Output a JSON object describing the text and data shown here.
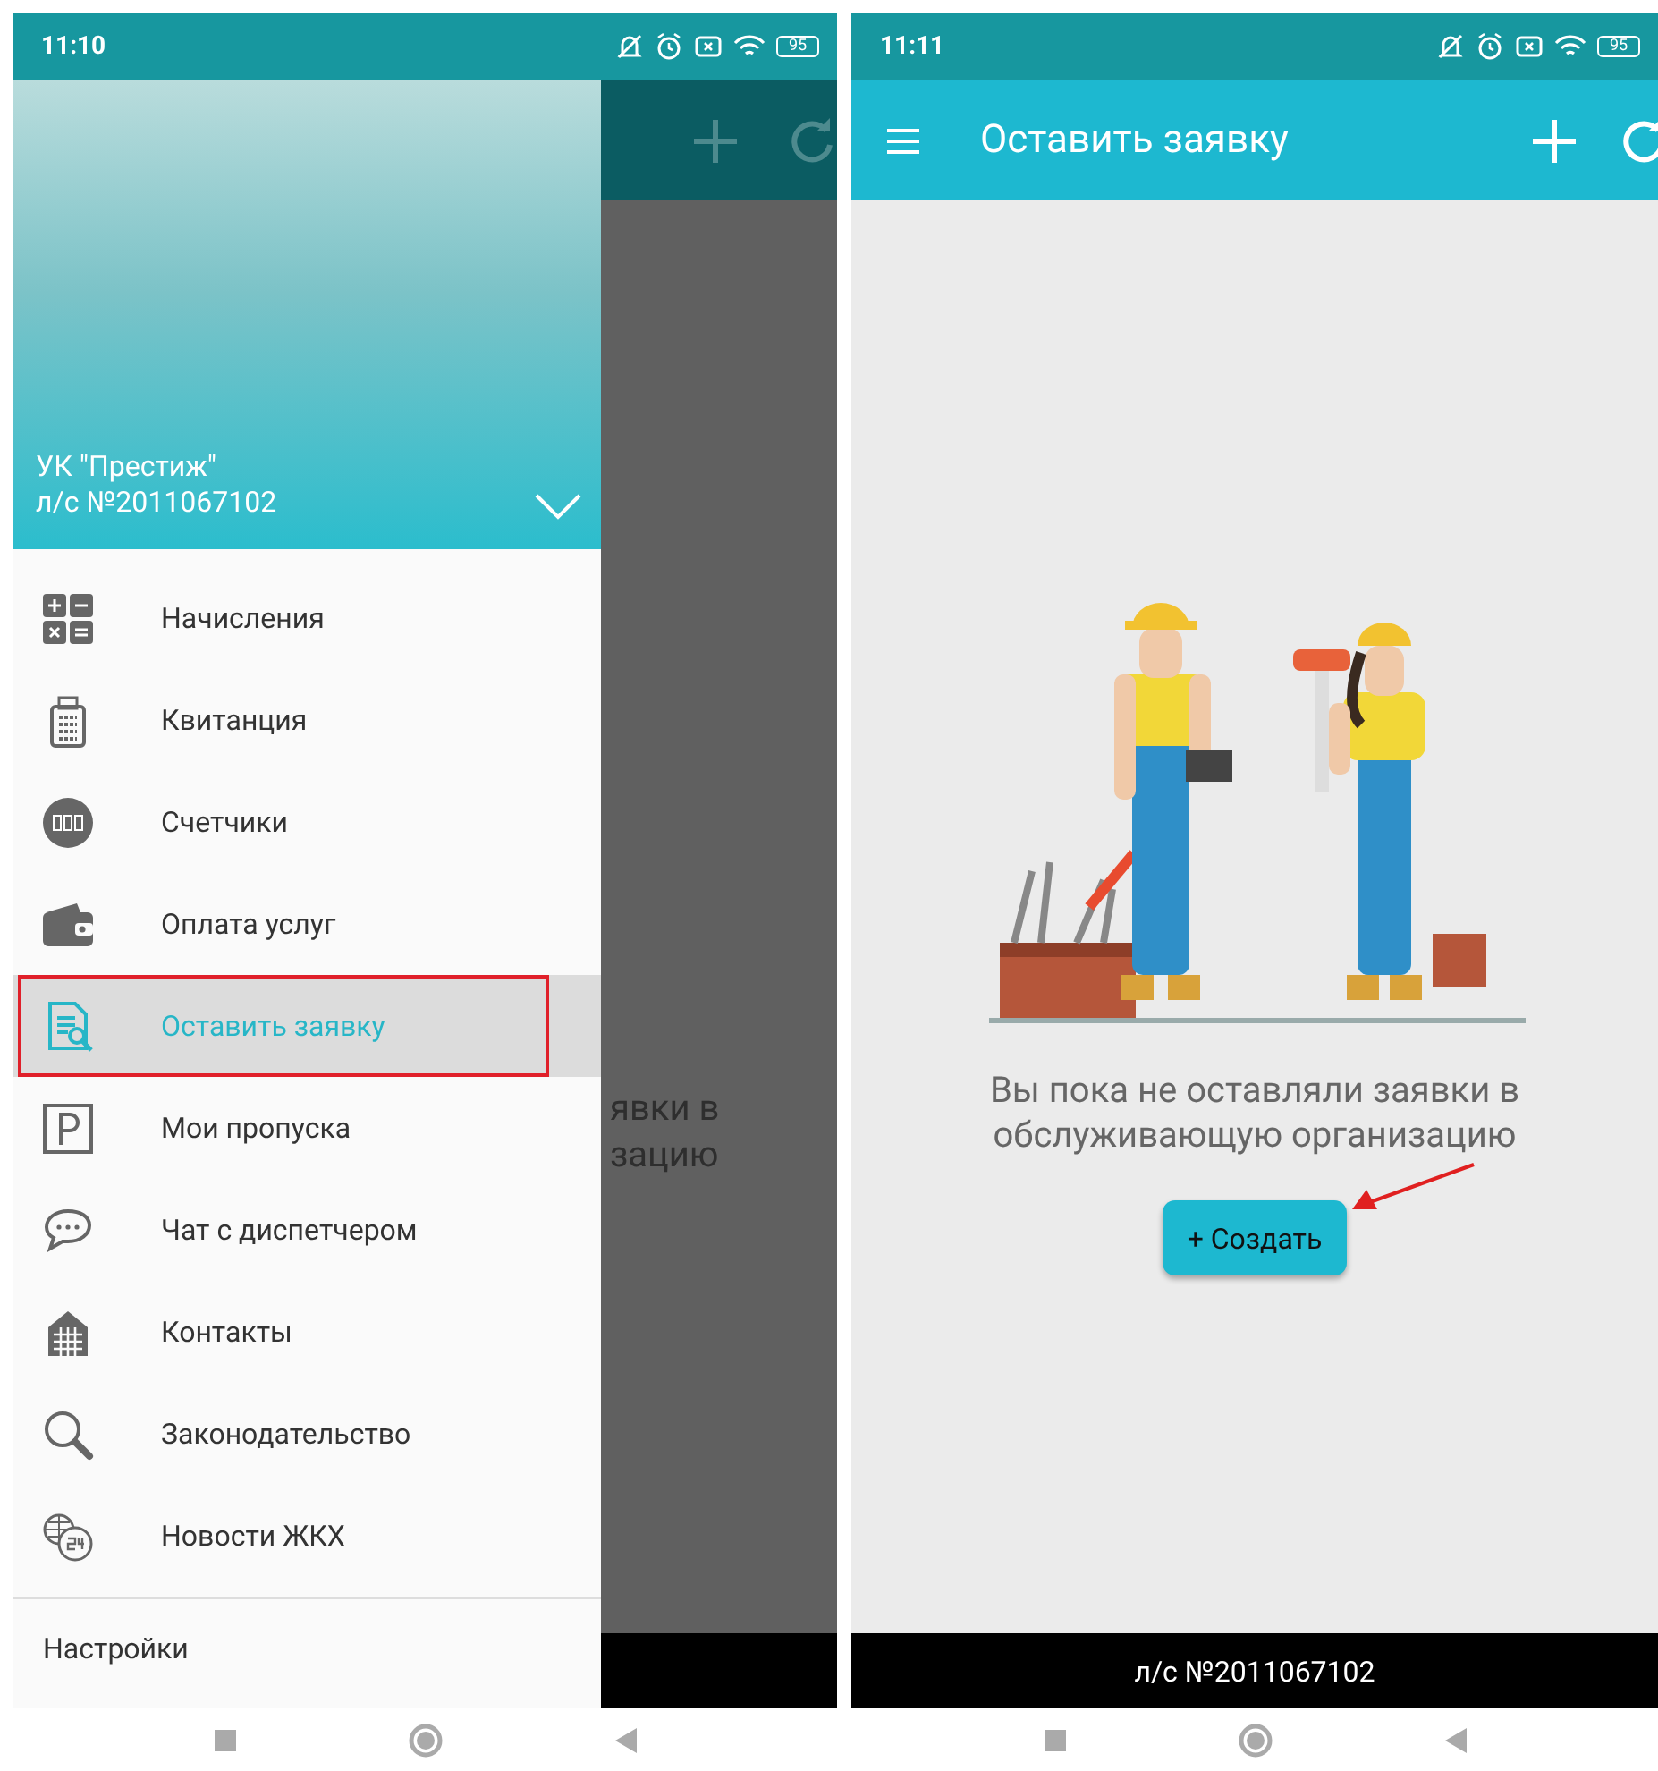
{
  "left_screen": {
    "status_bar": {
      "time": "11:10",
      "battery": "95"
    },
    "background": {
      "texts": [
        "явки в",
        "зацию"
      ]
    },
    "drawer": {
      "header": {
        "company": "УК \"Престиж\"",
        "account": "л/с №2011067102"
      },
      "items": [
        {
          "label": "Начисления",
          "selected": false
        },
        {
          "label": "Квитанция",
          "selected": false
        },
        {
          "label": "Счетчики",
          "selected": false
        },
        {
          "label": "Оплата услуг",
          "selected": false
        },
        {
          "label": "Оставить заявку",
          "selected": true
        },
        {
          "label": "Мои пропуска",
          "selected": false
        },
        {
          "label": "Чат с диспетчером",
          "selected": false
        },
        {
          "label": "Контакты",
          "selected": false
        },
        {
          "label": "Законодательство",
          "selected": false
        },
        {
          "label": "Новости ЖКХ",
          "selected": false
        }
      ],
      "settings": "Настройки"
    }
  },
  "right_screen": {
    "status_bar": {
      "time": "11:11",
      "battery": "95"
    },
    "app_bar": {
      "title": "Оставить заявку"
    },
    "empty_state": {
      "message": "Вы пока не оставляли заявки в обслуживающую организацию",
      "button": "+ Создать"
    },
    "footer": "л/с №2011067102"
  }
}
